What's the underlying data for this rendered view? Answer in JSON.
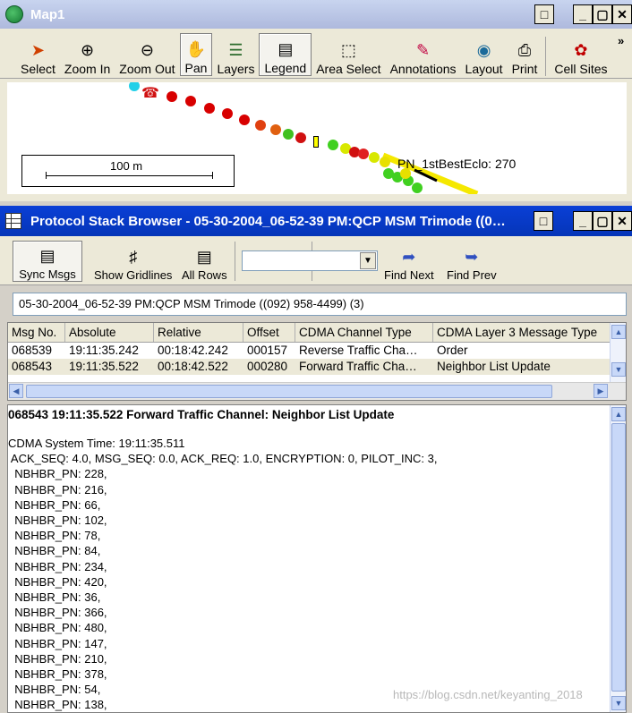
{
  "map_window": {
    "title": "Map1",
    "toolbar": [
      {
        "label": "Select",
        "icon": "cursor-icon"
      },
      {
        "label": "Zoom In",
        "icon": "zoom-in-icon"
      },
      {
        "label": "Zoom Out",
        "icon": "zoom-out-icon"
      },
      {
        "label": "Pan",
        "icon": "hand-icon"
      },
      {
        "label": "Layers",
        "icon": "layers-icon"
      },
      {
        "label": "Legend",
        "icon": "legend-icon"
      },
      {
        "label": "Area Select",
        "icon": "area-select-icon"
      },
      {
        "label": "Annotations",
        "icon": "annotations-icon"
      },
      {
        "label": "Layout",
        "icon": "layout-icon"
      },
      {
        "label": "Print",
        "icon": "print-icon"
      },
      {
        "label": "Cell Sites",
        "icon": "cell-sites-icon"
      }
    ],
    "overflow": "»",
    "scale_label": "100 m",
    "map_label": "PN_1stBestEclo: 270"
  },
  "psb_window": {
    "title": "Protocol Stack Browser - 05-30-2004_06-52-39 PM:QCP MSM Trimode ((0…",
    "toolbar": {
      "sync": "Sync Msgs",
      "gridlines": "Show Gridlines",
      "all_rows": "All Rows",
      "find_next": "Find Next",
      "find_prev": "Find Prev"
    },
    "info": "05-30-2004_06-52-39 PM:QCP MSM Trimode ((092) 958-4499) (3)",
    "columns": [
      "Msg No.",
      "Absolute",
      "Relative",
      "Offset",
      "CDMA Channel Type",
      "CDMA Layer 3 Message Type"
    ],
    "rows": [
      [
        "068539",
        "19:11:35.242",
        "00:18:42.242",
        "000157",
        "Reverse Traffic Cha…",
        "Order"
      ],
      [
        "068543",
        "19:11:35.522",
        "00:18:42.522",
        "000280",
        "Forward Traffic Cha…",
        "Neighbor List Update"
      ]
    ],
    "detail_header": "068543 19:11:35.522 Forward Traffic Channel: Neighbor List Update",
    "detail_lines": [
      "CDMA System Time: 19:11:35.511",
      " ACK_SEQ: 4.0, MSG_SEQ: 0.0, ACK_REQ: 1.0, ENCRYPTION: 0, PILOT_INC: 3,",
      "  NBHBR_PN: 228,",
      "  NBHBR_PN: 216,",
      "  NBHBR_PN: 66,",
      "  NBHBR_PN: 102,",
      "  NBHBR_PN: 78,",
      "  NBHBR_PN: 84,",
      "  NBHBR_PN: 234,",
      "  NBHBR_PN: 420,",
      "  NBHBR_PN: 36,",
      "  NBHBR_PN: 366,",
      "  NBHBR_PN: 480,",
      "  NBHBR_PN: 147,",
      "  NBHBR_PN: 210,",
      "  NBHBR_PN: 378,",
      "  NBHBR_PN: 54,",
      "  NBHBR_PN: 138,"
    ],
    "watermark": "https://blog.csdn.net/keyanting_2018"
  },
  "colors": {
    "title_active": "#0a3fd6",
    "title_inactive": "#aeb9dd",
    "selection": "#ece9d8"
  }
}
